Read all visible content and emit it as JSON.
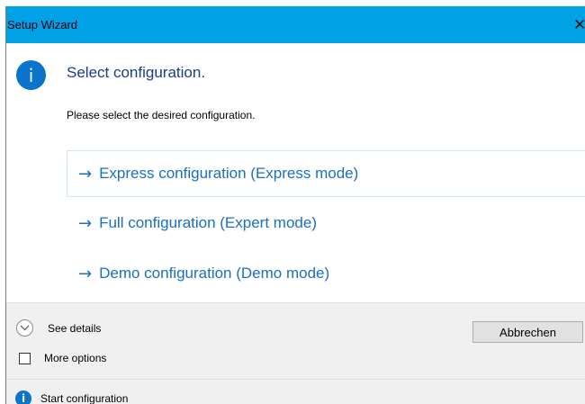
{
  "window": {
    "title": "Setup Wizard",
    "close_glyph": "✕"
  },
  "dialog": {
    "main_icon": "i",
    "main_instruction": "Select configuration.",
    "content": "Please select the desired configuration."
  },
  "command_links": [
    {
      "arrow": "→",
      "label": "Express configuration (Express mode)"
    },
    {
      "arrow": "→",
      "label": "Full configuration (Expert mode)"
    },
    {
      "arrow": "→",
      "label": "Demo configuration (Demo mode)"
    }
  ],
  "footer": {
    "details_label": "See details",
    "cancel_label": "Abbrechen",
    "checkbox_label": "More options",
    "checkbox_checked": false,
    "footer_icon": "i",
    "footer_text": "Start configuration"
  },
  "colors": {
    "titlebar": "#00a1e6",
    "instruction_text": "#1a3b8c",
    "link_text": "#1a6fc0",
    "info_icon": "#0a74cc",
    "footer_bg": "#f0f0f0"
  }
}
